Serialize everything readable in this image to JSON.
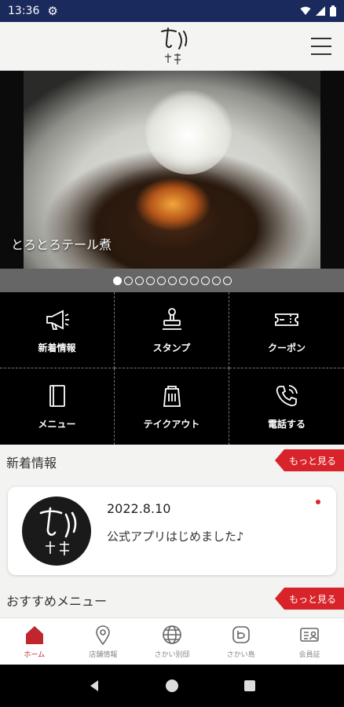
{
  "status_bar": {
    "time": "13:36"
  },
  "header": {
    "logo_text": "さかい 別邸"
  },
  "hero": {
    "caption": "とろとろテール煮",
    "slide_count": 11,
    "active_index": 0
  },
  "menu_grid": [
    {
      "label": "新着情報",
      "icon": "megaphone-icon"
    },
    {
      "label": "スタンプ",
      "icon": "stamp-icon"
    },
    {
      "label": "クーポン",
      "icon": "coupon-icon"
    },
    {
      "label": "メニュー",
      "icon": "menu-book-icon"
    },
    {
      "label": "テイクアウト",
      "icon": "takeout-bag-icon"
    },
    {
      "label": "電話する",
      "icon": "phone-icon"
    }
  ],
  "news": {
    "title": "新着情報",
    "more_label": "もっと見る",
    "items": [
      {
        "date": "2022.8.10",
        "text": "公式アプリはじめました♪"
      }
    ]
  },
  "recommended": {
    "title": "おすすめメニュー",
    "more_label": "もっと見る"
  },
  "tabs": [
    {
      "label": "ホーム",
      "icon": "home-icon"
    },
    {
      "label": "店舗情報",
      "icon": "map-pin-icon"
    },
    {
      "label": "さかい別邸",
      "icon": "globe-icon"
    },
    {
      "label": "さかい島",
      "icon": "blog-icon"
    },
    {
      "label": "会員証",
      "icon": "member-card-icon"
    }
  ],
  "colors": {
    "status_bar": "#1a2a5c",
    "accent": "#d8232a",
    "grid_bg": "#000000"
  }
}
